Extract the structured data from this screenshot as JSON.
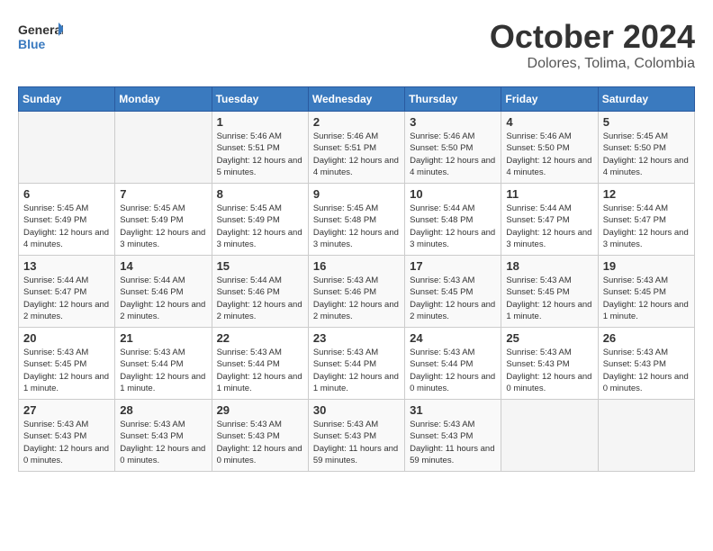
{
  "header": {
    "logo": {
      "general": "General",
      "blue": "Blue"
    },
    "month": "October 2024",
    "location": "Dolores, Tolima, Colombia"
  },
  "weekdays": [
    "Sunday",
    "Monday",
    "Tuesday",
    "Wednesday",
    "Thursday",
    "Friday",
    "Saturday"
  ],
  "weeks": [
    [
      {
        "day": "",
        "info": ""
      },
      {
        "day": "",
        "info": ""
      },
      {
        "day": "1",
        "info": "Sunrise: 5:46 AM\nSunset: 5:51 PM\nDaylight: 12 hours and 5 minutes."
      },
      {
        "day": "2",
        "info": "Sunrise: 5:46 AM\nSunset: 5:51 PM\nDaylight: 12 hours and 4 minutes."
      },
      {
        "day": "3",
        "info": "Sunrise: 5:46 AM\nSunset: 5:50 PM\nDaylight: 12 hours and 4 minutes."
      },
      {
        "day": "4",
        "info": "Sunrise: 5:46 AM\nSunset: 5:50 PM\nDaylight: 12 hours and 4 minutes."
      },
      {
        "day": "5",
        "info": "Sunrise: 5:45 AM\nSunset: 5:50 PM\nDaylight: 12 hours and 4 minutes."
      }
    ],
    [
      {
        "day": "6",
        "info": "Sunrise: 5:45 AM\nSunset: 5:49 PM\nDaylight: 12 hours and 4 minutes."
      },
      {
        "day": "7",
        "info": "Sunrise: 5:45 AM\nSunset: 5:49 PM\nDaylight: 12 hours and 3 minutes."
      },
      {
        "day": "8",
        "info": "Sunrise: 5:45 AM\nSunset: 5:49 PM\nDaylight: 12 hours and 3 minutes."
      },
      {
        "day": "9",
        "info": "Sunrise: 5:45 AM\nSunset: 5:48 PM\nDaylight: 12 hours and 3 minutes."
      },
      {
        "day": "10",
        "info": "Sunrise: 5:44 AM\nSunset: 5:48 PM\nDaylight: 12 hours and 3 minutes."
      },
      {
        "day": "11",
        "info": "Sunrise: 5:44 AM\nSunset: 5:47 PM\nDaylight: 12 hours and 3 minutes."
      },
      {
        "day": "12",
        "info": "Sunrise: 5:44 AM\nSunset: 5:47 PM\nDaylight: 12 hours and 3 minutes."
      }
    ],
    [
      {
        "day": "13",
        "info": "Sunrise: 5:44 AM\nSunset: 5:47 PM\nDaylight: 12 hours and 2 minutes."
      },
      {
        "day": "14",
        "info": "Sunrise: 5:44 AM\nSunset: 5:46 PM\nDaylight: 12 hours and 2 minutes."
      },
      {
        "day": "15",
        "info": "Sunrise: 5:44 AM\nSunset: 5:46 PM\nDaylight: 12 hours and 2 minutes."
      },
      {
        "day": "16",
        "info": "Sunrise: 5:43 AM\nSunset: 5:46 PM\nDaylight: 12 hours and 2 minutes."
      },
      {
        "day": "17",
        "info": "Sunrise: 5:43 AM\nSunset: 5:45 PM\nDaylight: 12 hours and 2 minutes."
      },
      {
        "day": "18",
        "info": "Sunrise: 5:43 AM\nSunset: 5:45 PM\nDaylight: 12 hours and 1 minute."
      },
      {
        "day": "19",
        "info": "Sunrise: 5:43 AM\nSunset: 5:45 PM\nDaylight: 12 hours and 1 minute."
      }
    ],
    [
      {
        "day": "20",
        "info": "Sunrise: 5:43 AM\nSunset: 5:45 PM\nDaylight: 12 hours and 1 minute."
      },
      {
        "day": "21",
        "info": "Sunrise: 5:43 AM\nSunset: 5:44 PM\nDaylight: 12 hours and 1 minute."
      },
      {
        "day": "22",
        "info": "Sunrise: 5:43 AM\nSunset: 5:44 PM\nDaylight: 12 hours and 1 minute."
      },
      {
        "day": "23",
        "info": "Sunrise: 5:43 AM\nSunset: 5:44 PM\nDaylight: 12 hours and 1 minute."
      },
      {
        "day": "24",
        "info": "Sunrise: 5:43 AM\nSunset: 5:44 PM\nDaylight: 12 hours and 0 minutes."
      },
      {
        "day": "25",
        "info": "Sunrise: 5:43 AM\nSunset: 5:43 PM\nDaylight: 12 hours and 0 minutes."
      },
      {
        "day": "26",
        "info": "Sunrise: 5:43 AM\nSunset: 5:43 PM\nDaylight: 12 hours and 0 minutes."
      }
    ],
    [
      {
        "day": "27",
        "info": "Sunrise: 5:43 AM\nSunset: 5:43 PM\nDaylight: 12 hours and 0 minutes."
      },
      {
        "day": "28",
        "info": "Sunrise: 5:43 AM\nSunset: 5:43 PM\nDaylight: 12 hours and 0 minutes."
      },
      {
        "day": "29",
        "info": "Sunrise: 5:43 AM\nSunset: 5:43 PM\nDaylight: 12 hours and 0 minutes."
      },
      {
        "day": "30",
        "info": "Sunrise: 5:43 AM\nSunset: 5:43 PM\nDaylight: 11 hours and 59 minutes."
      },
      {
        "day": "31",
        "info": "Sunrise: 5:43 AM\nSunset: 5:43 PM\nDaylight: 11 hours and 59 minutes."
      },
      {
        "day": "",
        "info": ""
      },
      {
        "day": "",
        "info": ""
      }
    ]
  ]
}
